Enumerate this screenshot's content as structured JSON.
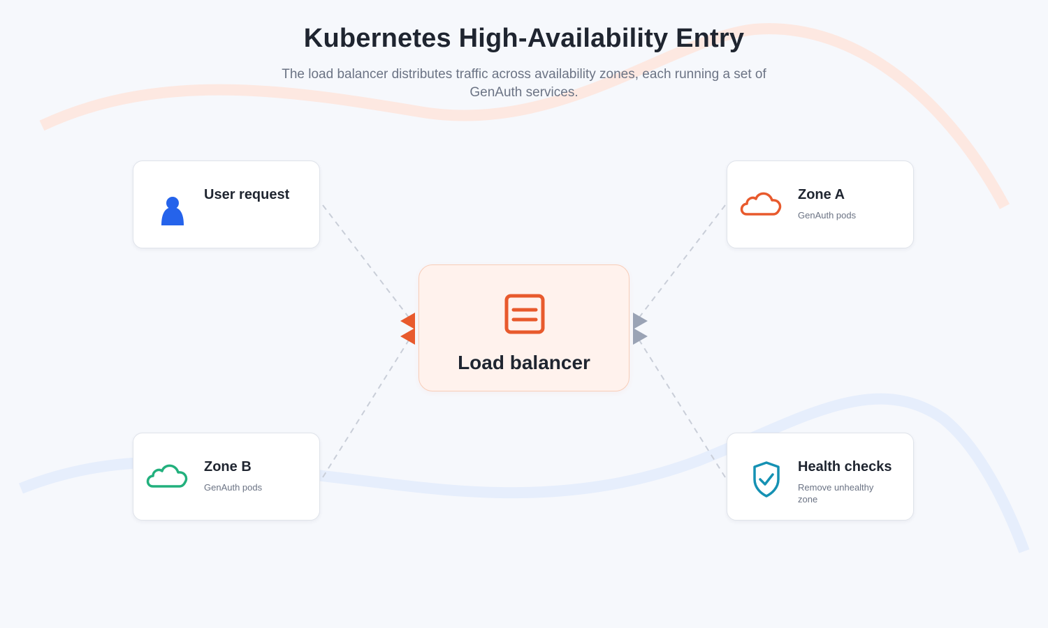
{
  "header": {
    "title": "Kubernetes High-Availability Entry",
    "subtitle": "The load balancer distributes traffic across availability zones, each running a set of GenAuth services."
  },
  "hub": {
    "label": "Load balancer",
    "icon": "server-list-icon"
  },
  "nodes": {
    "user": {
      "label": "User request",
      "sub": "",
      "icon": "user-icon"
    },
    "zone_a": {
      "label": "Zone A",
      "sub": "GenAuth pods",
      "icon": "cloud-icon"
    },
    "zone_b": {
      "label": "Zone B",
      "sub": "GenAuth pods",
      "icon": "cloud-icon"
    },
    "health": {
      "label": "Health checks",
      "sub": "Remove unhealthy zone",
      "icon": "shield-check-icon"
    }
  },
  "colors": {
    "background": "#f6f8fc",
    "accent": "#e85a2d",
    "hub_fill": "#fff2ed",
    "user_icon": "#2563eb",
    "zone_a_icon": "#e85a2d",
    "zone_b_icon": "#22b07d",
    "health_icon": "#1591b3",
    "arrow_gray": "#9aa3b5",
    "connector": "#c9ced8",
    "wave_top": "#fde8e1",
    "wave_bottom": "#e6eefc"
  }
}
